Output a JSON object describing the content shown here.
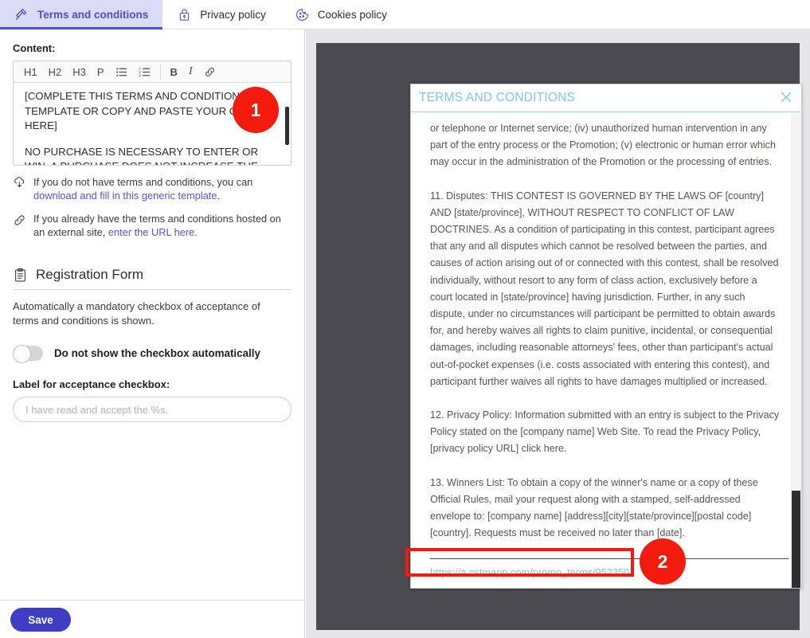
{
  "tabs": [
    {
      "id": "terms",
      "label": "Terms and conditions",
      "icon": "gavel-icon",
      "active": true
    },
    {
      "id": "privacy",
      "label": "Privacy policy",
      "icon": "padlock-icon",
      "active": false
    },
    {
      "id": "cookies",
      "label": "Cookies policy",
      "icon": "cookie-icon",
      "active": false
    }
  ],
  "left_panel": {
    "content_label": "Content:",
    "toolbar": {
      "h1": "H1",
      "h2": "H2",
      "h3": "H3",
      "p": "P",
      "bullet_list": "bullet-list-icon",
      "numbered_list": "numbered-list-icon",
      "bold": "B",
      "italic": "I",
      "link": "link-icon"
    },
    "editor_text": {
      "paragraph_1": "[COMPLETE THIS TERMS AND CONDITIONS TEMPLATE OR COPY AND PASTE YOUR OWN HERE]",
      "paragraph_2": "NO PURCHASE IS NECESSARY TO ENTER OR WIN. A PURCHASE DOES NOT INCREASE THE CHANCES"
    },
    "hints": [
      {
        "icon": "cloud-download-icon",
        "text_before": "If you do not have terms and conditions, you can ",
        "link": "download and fill in this generic template",
        "text_after": "."
      },
      {
        "icon": "link-icon",
        "text_before": "If you already have the terms and conditions hosted on an external site, ",
        "link": "enter the URL here",
        "text_after": "."
      }
    ],
    "registration": {
      "icon": "clipboard-icon",
      "title": "Registration Form",
      "description": "Automatically a mandatory checkbox of acceptance of terms and conditions is shown.",
      "toggle_label": "Do not show the checkbox automatically",
      "toggle_state": "off",
      "field_label": "Label for acceptance checkbox:",
      "field_value": "",
      "field_placeholder": "I have read and accept the %s."
    },
    "save_label": "Save"
  },
  "preview": {
    "modal": {
      "title": "TERMS AND CONDITIONS",
      "close_icon": "close-icon",
      "paragraphs": [
        "or telephone or Internet service; (iv) unauthorized human intervention in any part of the entry process or the Promotion; (v) electronic or human error which may occur in the administration of the Promotion or the processing of entries.",
        "11. Disputes: THIS CONTEST IS GOVERNED BY THE LAWS OF [country] AND [state/province], WITHOUT RESPECT TO CONFLICT OF LAW DOCTRINES. As a condition of participating in this contest, participant agrees that any and all disputes which cannot be resolved between the parties, and causes of action arising out of or connected with this contest, shall be resolved individually, without resort to any form of class action, exclusively before a court located in [state/province] having jurisdiction. Further, in any such dispute, under no circumstances will participant be permitted to obtain awards for, and hereby waives all rights to claim punitive, incidental, or consequential damages, including reasonable attorneys' fees, other than participant's actual out-of-pocket expenses (i.e. costs associated with entering this contest), and participant further waives all rights to have damages multiplied or increased.",
        "12. Privacy Policy: Information submitted with an entry is subject to the Privacy Policy stated on the [company name] Web Site. To read the Privacy Policy, [privacy policy URL] click here.",
        "13. Winners List: To obtain a copy of the winner's name or a copy of these Official Rules, mail your request along with a stamped, self-addressed envelope to: [company name] [address][city][state/province][postal code][country]. Requests must be received no later than [date]."
      ],
      "url": "https://a.cstmapp.com/promo_terms/952350"
    }
  },
  "annotations": [
    {
      "id": "1",
      "number": "1"
    },
    {
      "id": "2",
      "number": "2"
    }
  ],
  "colors": {
    "accent": "#4f52c9",
    "active_tab_bg": "#dadbf5",
    "save_button": "#3d3ec4",
    "link": "#5356cf",
    "preview_backdrop": "#4b4b4f",
    "modal_title": "#86c6dc",
    "annotation_red": "#f21b0e"
  }
}
